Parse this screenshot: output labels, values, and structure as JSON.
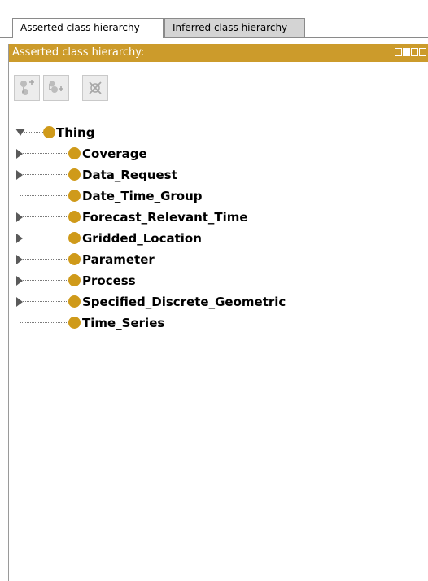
{
  "tabs": [
    {
      "label": "Asserted class hierarchy",
      "active": true
    },
    {
      "label": "Inferred class hierarchy",
      "active": false
    }
  ],
  "panel": {
    "title": "Asserted class hierarchy:",
    "title_bg": "#cc9b2b",
    "toolbar": [
      "add-subclass-icon",
      "add-sibling-class-icon",
      "delete-class-icon"
    ]
  },
  "tree": {
    "root": {
      "label": "Thing",
      "expanded": true
    },
    "children": [
      {
        "label": "Coverage",
        "expandable": true
      },
      {
        "label": "Data_Request",
        "expandable": true
      },
      {
        "label": "Date_Time_Group",
        "expandable": false
      },
      {
        "label": "Forecast_Relevant_Time",
        "expandable": true
      },
      {
        "label": "Gridded_Location",
        "expandable": true
      },
      {
        "label": "Parameter",
        "expandable": true
      },
      {
        "label": "Process",
        "expandable": true
      },
      {
        "label": "Specified_Discrete_Geometric",
        "expandable": true
      },
      {
        "label": "Time_Series",
        "expandable": false
      }
    ],
    "class_dot_color": "#cf9a1a"
  }
}
